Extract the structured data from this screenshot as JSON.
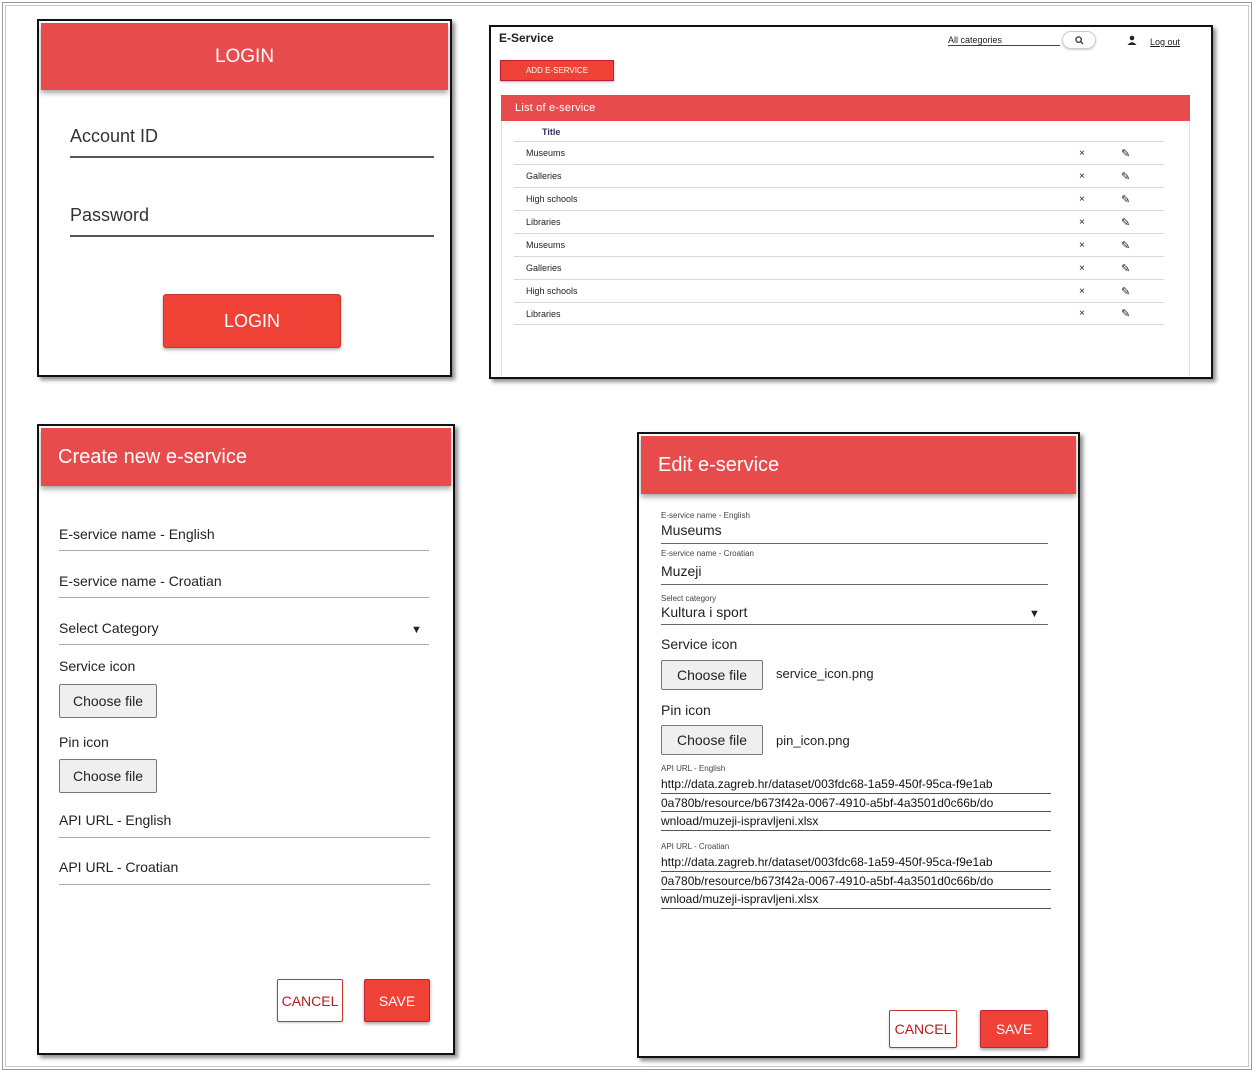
{
  "login": {
    "title": "LOGIN",
    "account_placeholder": "Account ID",
    "password_placeholder": "Password",
    "button": "LOGIN"
  },
  "list": {
    "app_title": "E-Service",
    "category_filter": "All categories",
    "search_icon": "search-icon",
    "user_icon": "person-icon",
    "logout": "Log out",
    "add_button": "ADD E-SERVICE",
    "section_title": "List of e-service",
    "column_title": "Title",
    "rows": [
      "Museums",
      "Galleries",
      "High schools",
      "Libraries",
      "Museums",
      "Galleries",
      "High schools",
      "Libraries"
    ],
    "delete_symbol": "×",
    "edit_symbol": "✎"
  },
  "create": {
    "title": "Create new e-service",
    "name_en_placeholder": "E-service name - English",
    "name_hr_placeholder": "E-service name - Croatian",
    "category_placeholder": "Select Category",
    "service_icon_label": "Service icon",
    "pin_icon_label": "Pin icon",
    "choose_file": "Choose file",
    "api_en_placeholder": "API URL - English",
    "api_hr_placeholder": "API URL - Croatian",
    "cancel": "CANCEL",
    "save": "SAVE"
  },
  "edit": {
    "title": "Edit e-service",
    "name_en_label": "E-service name - English",
    "name_en_value": "Museums",
    "name_hr_label": "E-service name - Croatian",
    "name_hr_value": "Muzeji",
    "category_label": "Select category",
    "category_value": "Kultura i sport",
    "service_icon_label": "Service icon",
    "service_icon_file": "service_icon.png",
    "pin_icon_label": "Pin icon",
    "pin_icon_file": "pin_icon.png",
    "choose_file": "Choose file",
    "api_en_label": "API URL - English",
    "api_en_lines": [
      "http://data.zagreb.hr/dataset/003fdc68-1a59-450f-95ca-f9e1ab",
      "0a780b/resource/b673f42a-0067-4910-a5bf-4a3501d0c66b/do",
      "wnload/muzeji-ispravljeni.xlsx"
    ],
    "api_hr_label": "API URL - Croatian",
    "api_hr_lines": [
      "http://data.zagreb.hr/dataset/003fdc68-1a59-450f-95ca-f9e1ab",
      "0a780b/resource/b673f42a-0067-4910-a5bf-4a3501d0c66b/do",
      "wnload/muzeji-ispravljeni.xlsx"
    ],
    "cancel": "CANCEL",
    "save": "SAVE"
  },
  "colors": {
    "accent": "#e84b4b",
    "button_red": "#ef4136"
  }
}
